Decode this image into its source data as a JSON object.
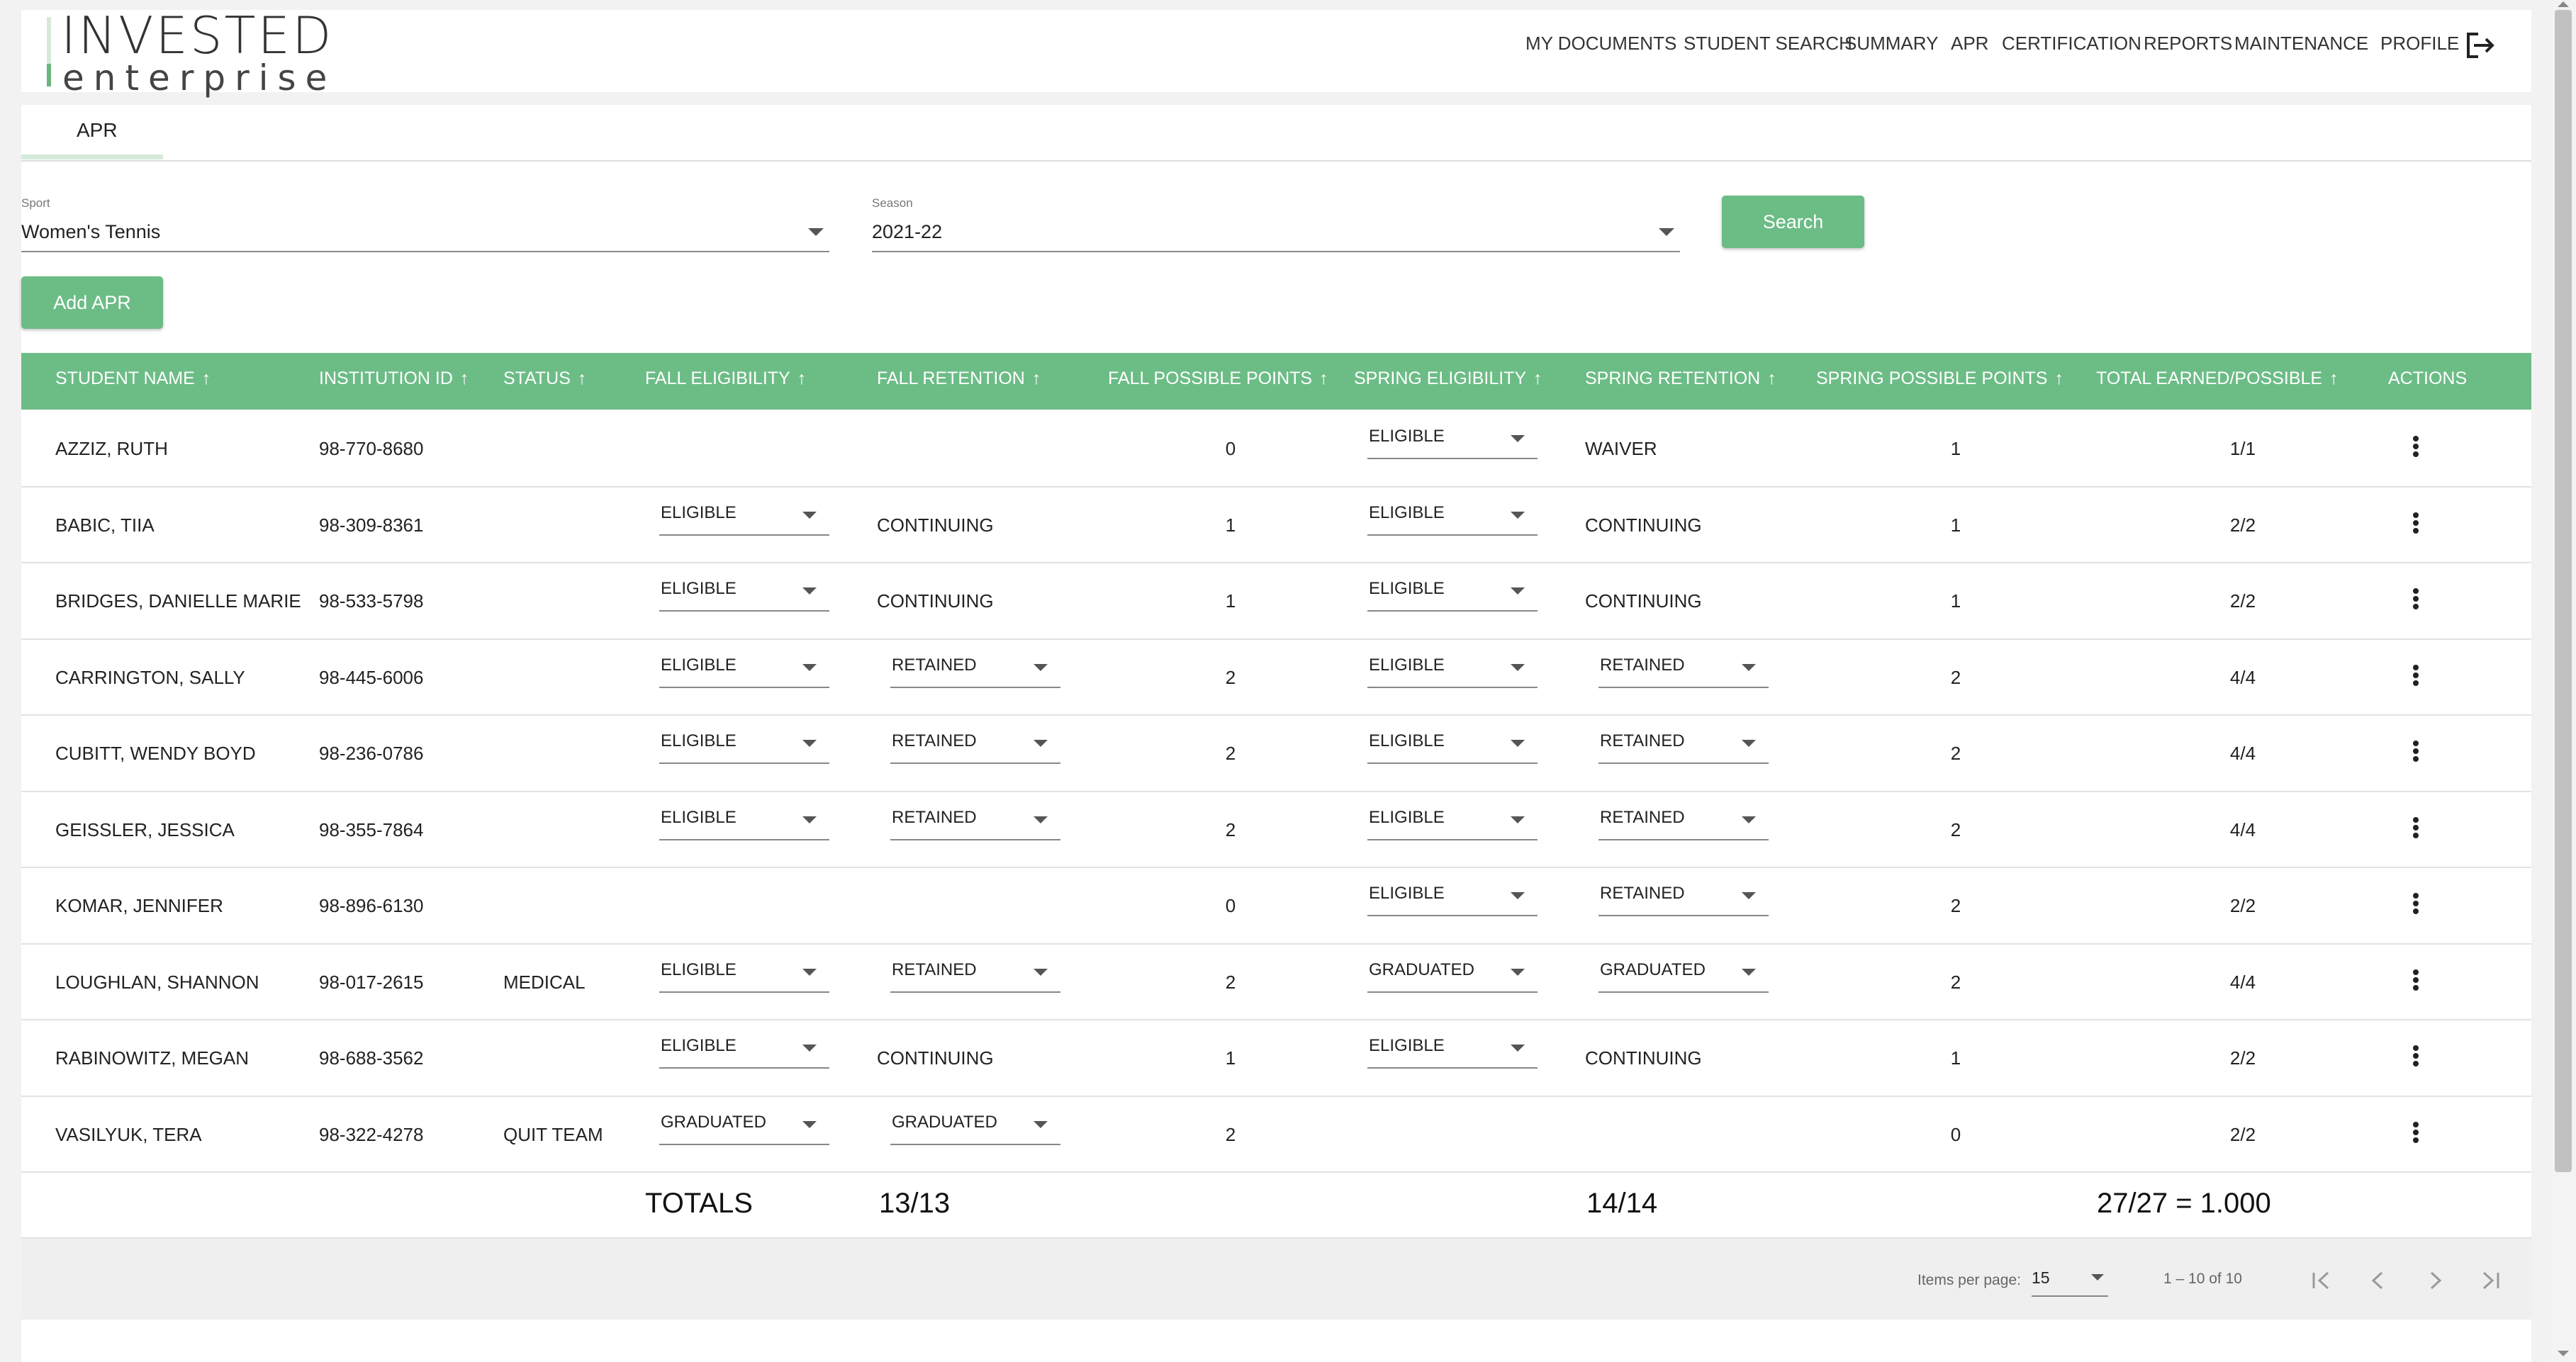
{
  "logo": {
    "line1": "INVESTED",
    "line2": "enterprise"
  },
  "nav": {
    "items": [
      "MY DOCUMENTS",
      "STUDENT SEARCH",
      "SUMMARY",
      "APR",
      "CERTIFICATION",
      "REPORTS",
      "MAINTENANCE",
      "PROFILE"
    ],
    "logout_icon": "logout-icon"
  },
  "tab": {
    "label": "APR"
  },
  "filters": {
    "sport_label": "Sport",
    "sport_value": "Women's Tennis",
    "season_label": "Season",
    "season_value": "2021-22",
    "search_label": "Search",
    "add_label": "Add APR"
  },
  "table": {
    "headers": [
      "STUDENT NAME",
      "INSTITUTION ID",
      "STATUS",
      "FALL ELIGIBILITY",
      "FALL RETENTION",
      "FALL POSSIBLE POINTS",
      "SPRING ELIGIBILITY",
      "SPRING RETENTION",
      "SPRING POSSIBLE POINTS",
      "TOTAL EARNED/POSSIBLE",
      "ACTIONS"
    ],
    "sort_icon": "arrow-up-icon",
    "rows": [
      {
        "name": "AZZIZ, RUTH",
        "id": "98-770-8680",
        "status": "",
        "fall_elig": {
          "value": "",
          "dropdown": false
        },
        "fall_ret": {
          "value": "",
          "dropdown": false
        },
        "fall_pts": "0",
        "spring_elig": {
          "value": "ELIGIBLE",
          "dropdown": true
        },
        "spring_ret": {
          "value": "WAIVER",
          "dropdown": false
        },
        "spring_pts": "1",
        "total": "1/1"
      },
      {
        "name": "BABIC, TIIA",
        "id": "98-309-8361",
        "status": "",
        "fall_elig": {
          "value": "ELIGIBLE",
          "dropdown": true
        },
        "fall_ret": {
          "value": "CONTINUING",
          "dropdown": false
        },
        "fall_pts": "1",
        "spring_elig": {
          "value": "ELIGIBLE",
          "dropdown": true
        },
        "spring_ret": {
          "value": "CONTINUING",
          "dropdown": false
        },
        "spring_pts": "1",
        "total": "2/2"
      },
      {
        "name": "BRIDGES, DANIELLE MARIE",
        "id": "98-533-5798",
        "status": "",
        "fall_elig": {
          "value": "ELIGIBLE",
          "dropdown": true
        },
        "fall_ret": {
          "value": "CONTINUING",
          "dropdown": false
        },
        "fall_pts": "1",
        "spring_elig": {
          "value": "ELIGIBLE",
          "dropdown": true
        },
        "spring_ret": {
          "value": "CONTINUING",
          "dropdown": false
        },
        "spring_pts": "1",
        "total": "2/2"
      },
      {
        "name": "CARRINGTON, SALLY",
        "id": "98-445-6006",
        "status": "",
        "fall_elig": {
          "value": "ELIGIBLE",
          "dropdown": true
        },
        "fall_ret": {
          "value": "RETAINED",
          "dropdown": true
        },
        "fall_pts": "2",
        "spring_elig": {
          "value": "ELIGIBLE",
          "dropdown": true
        },
        "spring_ret": {
          "value": "RETAINED",
          "dropdown": true
        },
        "spring_pts": "2",
        "total": "4/4"
      },
      {
        "name": "CUBITT, WENDY BOYD",
        "id": "98-236-0786",
        "status": "",
        "fall_elig": {
          "value": "ELIGIBLE",
          "dropdown": true
        },
        "fall_ret": {
          "value": "RETAINED",
          "dropdown": true
        },
        "fall_pts": "2",
        "spring_elig": {
          "value": "ELIGIBLE",
          "dropdown": true
        },
        "spring_ret": {
          "value": "RETAINED",
          "dropdown": true
        },
        "spring_pts": "2",
        "total": "4/4"
      },
      {
        "name": "GEISSLER, JESSICA",
        "id": "98-355-7864",
        "status": "",
        "fall_elig": {
          "value": "ELIGIBLE",
          "dropdown": true
        },
        "fall_ret": {
          "value": "RETAINED",
          "dropdown": true
        },
        "fall_pts": "2",
        "spring_elig": {
          "value": "ELIGIBLE",
          "dropdown": true
        },
        "spring_ret": {
          "value": "RETAINED",
          "dropdown": true
        },
        "spring_pts": "2",
        "total": "4/4"
      },
      {
        "name": "KOMAR, JENNIFER",
        "id": "98-896-6130",
        "status": "",
        "fall_elig": {
          "value": "",
          "dropdown": false
        },
        "fall_ret": {
          "value": "",
          "dropdown": false
        },
        "fall_pts": "0",
        "spring_elig": {
          "value": "ELIGIBLE",
          "dropdown": true
        },
        "spring_ret": {
          "value": "RETAINED",
          "dropdown": true
        },
        "spring_pts": "2",
        "total": "2/2"
      },
      {
        "name": "LOUGHLAN, SHANNON",
        "id": "98-017-2615",
        "status": "MEDICAL",
        "fall_elig": {
          "value": "ELIGIBLE",
          "dropdown": true
        },
        "fall_ret": {
          "value": "RETAINED",
          "dropdown": true
        },
        "fall_pts": "2",
        "spring_elig": {
          "value": "GRADUATED",
          "dropdown": true
        },
        "spring_ret": {
          "value": "GRADUATED",
          "dropdown": true
        },
        "spring_pts": "2",
        "total": "4/4"
      },
      {
        "name": "RABINOWITZ, MEGAN",
        "id": "98-688-3562",
        "status": "",
        "fall_elig": {
          "value": "ELIGIBLE",
          "dropdown": true
        },
        "fall_ret": {
          "value": "CONTINUING",
          "dropdown": false
        },
        "fall_pts": "1",
        "spring_elig": {
          "value": "ELIGIBLE",
          "dropdown": true
        },
        "spring_ret": {
          "value": "CONTINUING",
          "dropdown": false
        },
        "spring_pts": "1",
        "total": "2/2"
      },
      {
        "name": "VASILYUK, TERA",
        "id": "98-322-4278",
        "status": "QUIT TEAM",
        "fall_elig": {
          "value": "GRADUATED",
          "dropdown": true
        },
        "fall_ret": {
          "value": "GRADUATED",
          "dropdown": true
        },
        "fall_pts": "2",
        "spring_elig": {
          "value": "",
          "dropdown": false
        },
        "spring_ret": {
          "value": "",
          "dropdown": false
        },
        "spring_pts": "0",
        "total": "2/2"
      }
    ],
    "actions_icon": "more-vertical-icon"
  },
  "totals": {
    "label": "TOTALS",
    "fall": "13/13",
    "spring": "14/14",
    "total": "27/27 = 1.000"
  },
  "paginator": {
    "items_label": "Items per page:",
    "items_value": "15",
    "range": "1 – 10 of 10"
  },
  "colors": {
    "accent": "#6cbc86",
    "header_text": "#ffffff",
    "background": "#f2f2f2"
  }
}
